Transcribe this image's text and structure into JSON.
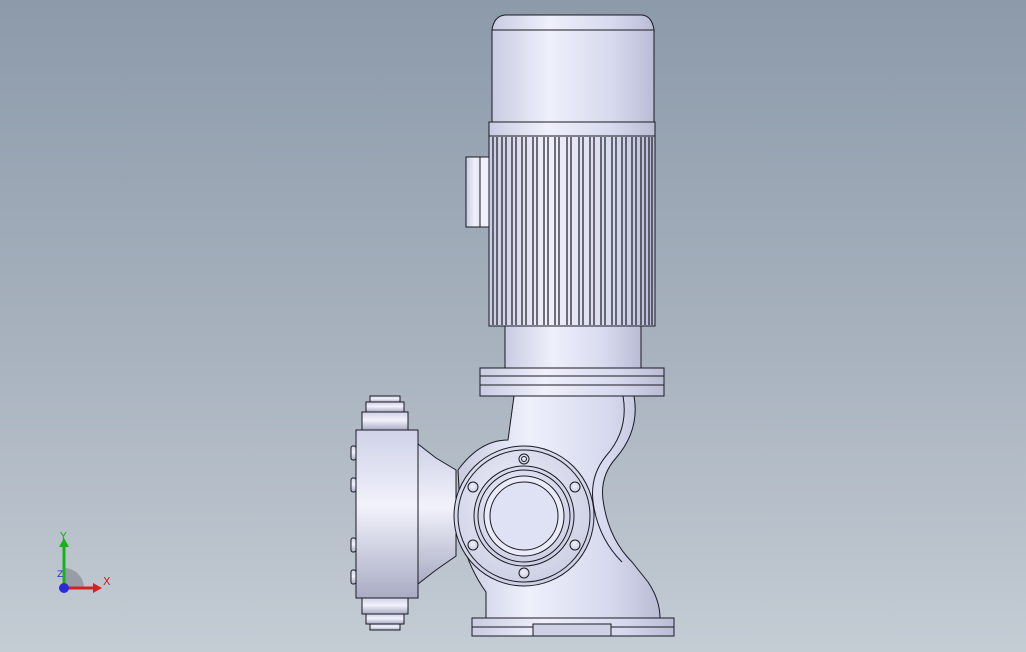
{
  "view": {
    "background_top": "#8c9aaa",
    "background_bottom": "#c4ccd4",
    "model_fill": "#dcdff2",
    "model_edge": "#1a1a22"
  },
  "triad": {
    "x_label": "X",
    "y_label": "Y",
    "z_label": "Z",
    "x_color": "#d62020",
    "y_color": "#19b219",
    "z_color": "#2a2ad8"
  }
}
